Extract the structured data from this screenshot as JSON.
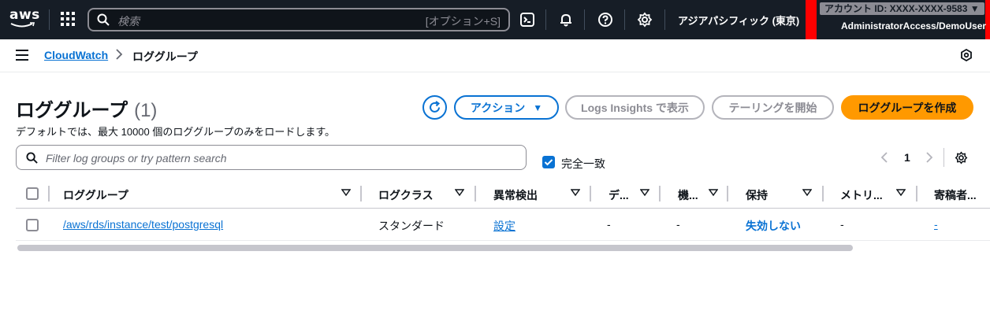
{
  "topnav": {
    "logo_text": "aws",
    "search_placeholder": "検索",
    "search_shortcut": "[オプション+S]",
    "region": "アジアパシフィック (東京)",
    "account_id": "アカウント ID: XXXX-XXXX-9583 ▼",
    "account_role": "AdministratorAccess/DemoUser"
  },
  "breadcrumb": {
    "service": "CloudWatch",
    "current": "ロググループ"
  },
  "header": {
    "title": "ロググループ",
    "count": "(1)",
    "description": "デフォルトでは、最大 10000 個のロググループのみをロードします。"
  },
  "actions": {
    "action_label": "アクション",
    "insights_label": "Logs Insights で表示",
    "tail_label": "テーリングを開始",
    "create_label": "ロググループを作成"
  },
  "filter": {
    "placeholder": "Filter log groups or try pattern search",
    "exact_match_label": "完全一致",
    "exact_match_checked": true
  },
  "pagination": {
    "current_page": "1"
  },
  "table": {
    "columns": [
      "ロググループ",
      "ログクラス",
      "異常検出",
      "デ...",
      "機...",
      "保持",
      "メトリ...",
      "寄稿者..."
    ],
    "rows": [
      {
        "log_group": "/aws/rds/instance/test/postgresql",
        "log_class": "スタンダード",
        "anomaly": "設定",
        "data_protection": "-",
        "sensitive": "-",
        "retention": "失効しない",
        "metric_filters": "-",
        "contributor": "-"
      }
    ]
  },
  "colors": {
    "nav_bg": "#161d26",
    "accent": "#0972d3",
    "primary_button": "#ff9900",
    "highlight_box": "#ff0000"
  }
}
